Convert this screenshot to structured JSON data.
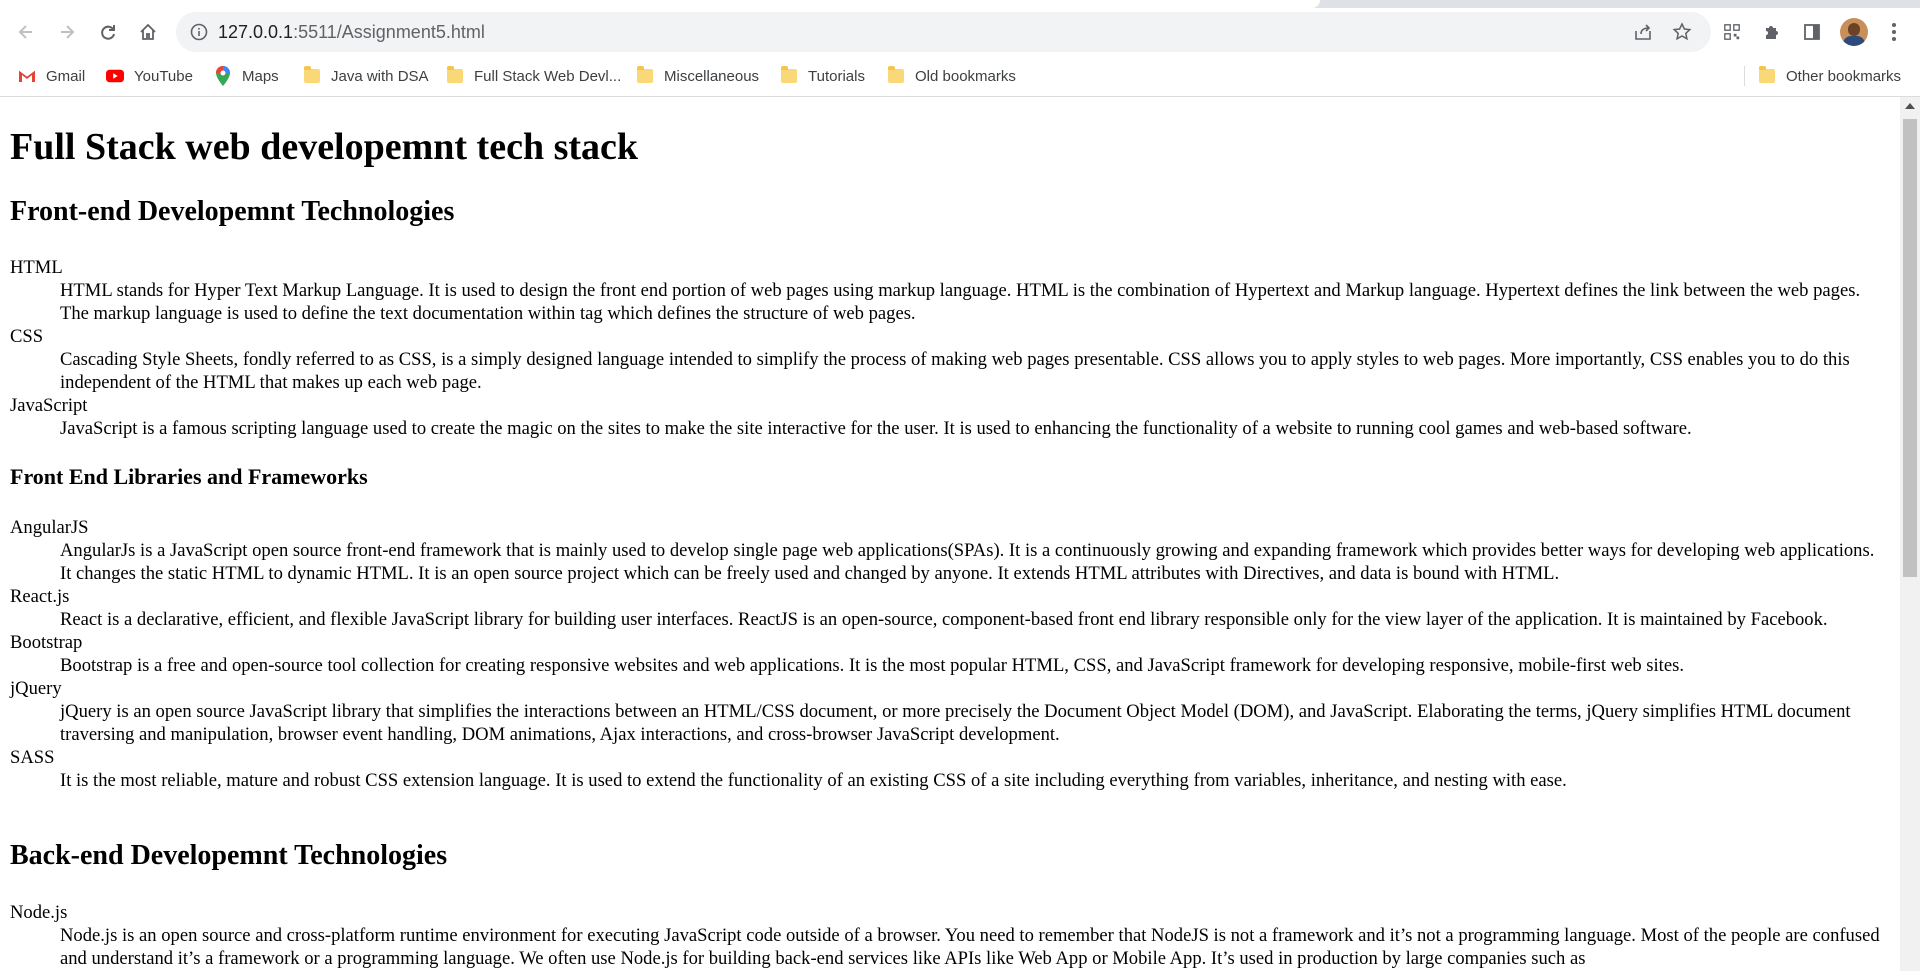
{
  "browser": {
    "url_host": "127.0.0.1",
    "url_path": ":5511/Assignment5.html"
  },
  "bookmarks": [
    {
      "label": "Gmail",
      "icon": "gmail-icon"
    },
    {
      "label": "YouTube",
      "icon": "youtube-icon"
    },
    {
      "label": "Maps",
      "icon": "maps-icon"
    },
    {
      "label": "Java with DSA",
      "icon": "folder-icon"
    },
    {
      "label": "Full Stack Web Devl...",
      "icon": "folder-icon"
    },
    {
      "label": "Miscellaneous",
      "icon": "folder-icon"
    },
    {
      "label": "Tutorials",
      "icon": "folder-icon"
    },
    {
      "label": "Old bookmarks",
      "icon": "folder-icon"
    }
  ],
  "other_bookmarks": "Other bookmarks",
  "page": {
    "title": "Full Stack web developemnt tech stack",
    "frontend_heading": "Front-end Developemnt Technologies",
    "frontend_terms": [
      {
        "term": "HTML",
        "desc": "HTML stands for Hyper Text Markup Language. It is used to design the front end portion of web pages using markup language. HTML is the combination of Hypertext and Markup language. Hypertext defines the link between the web pages. The markup language is used to define the text documentation within tag which defines the structure of web pages."
      },
      {
        "term": "CSS",
        "desc": "Cascading Style Sheets, fondly referred to as CSS, is a simply designed language intended to simplify the process of making web pages presentable. CSS allows you to apply styles to web pages. More importantly, CSS enables you to do this independent of the HTML that makes up each web page."
      },
      {
        "term": "JavaScript",
        "desc": "JavaScript is a famous scripting language used to create the magic on the sites to make the site interactive for the user. It is used to enhancing the functionality of a website to running cool games and web-based software."
      }
    ],
    "libraries_heading": "Front End Libraries and Frameworks",
    "library_terms": [
      {
        "term": "AngularJS",
        "desc": "AngularJs is a JavaScript open source front-end framework that is mainly used to develop single page web applications(SPAs). It is a continuously growing and expanding framework which provides better ways for developing web applications. It changes the static HTML to dynamic HTML. It is an open source project which can be freely used and changed by anyone. It extends HTML attributes with Directives, and data is bound with HTML."
      },
      {
        "term": "React.js",
        "desc": "React is a declarative, efficient, and flexible JavaScript library for building user interfaces. ReactJS is an open-source, component-based front end library responsible only for the view layer of the application. It is maintained by Facebook."
      },
      {
        "term": "Bootstrap",
        "desc": "Bootstrap is a free and open-source tool collection for creating responsive websites and web applications. It is the most popular HTML, CSS, and JavaScript framework for developing responsive, mobile-first web sites."
      },
      {
        "term": "jQuery",
        "desc": "jQuery is an open source JavaScript library that simplifies the interactions between an HTML/CSS document, or more precisely the Document Object Model (DOM), and JavaScript. Elaborating the terms, jQuery simplifies HTML document traversing and manipulation, browser event handling, DOM animations, Ajax interactions, and cross-browser JavaScript development."
      },
      {
        "term": "SASS",
        "desc": "It is the most reliable, mature and robust CSS extension language. It is used to extend the functionality of an existing CSS of a site including everything from variables, inheritance, and nesting with ease."
      }
    ],
    "backend_heading": "Back-end Developemnt Technologies",
    "backend_terms": [
      {
        "term": "Node.js",
        "desc": "Node.js is an open source and cross-platform runtime environment for executing JavaScript code outside of a browser. You need to remember that NodeJS is not a framework and it’s not a programming language. Most of the people are confused and understand it’s a framework or a programming language. We often use Node.js for building back-end services like APIs like Web App or Mobile App. It’s used in production by large companies such as"
      }
    ]
  }
}
